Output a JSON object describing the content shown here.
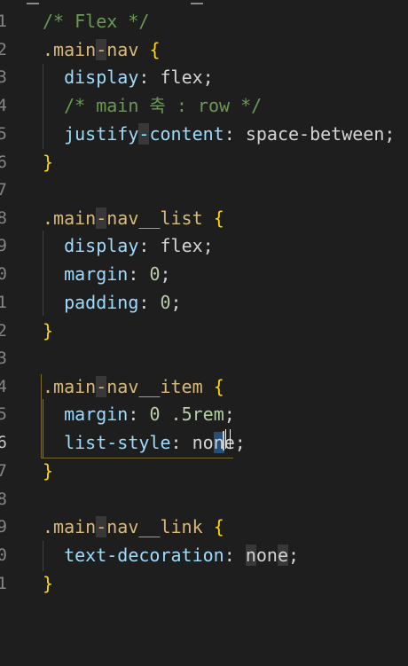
{
  "editor": {
    "language": "CSS",
    "active_line_number": "6",
    "lines": [
      {
        "number": "1",
        "text": "/* Flex */"
      },
      {
        "number": "2",
        "text": ".main-nav {"
      },
      {
        "number": "3",
        "text": "  display: flex;"
      },
      {
        "number": "4",
        "text": "  /* main 축 : row */"
      },
      {
        "number": "5",
        "text": "  justify-content: space-between;"
      },
      {
        "number": "6",
        "text": "}"
      },
      {
        "number": "7",
        "text": ""
      },
      {
        "number": "8",
        "text": ".main-nav__list {"
      },
      {
        "number": "9",
        "text": "  display: flex;"
      },
      {
        "number": "0",
        "text": "  margin: 0;"
      },
      {
        "number": "1",
        "text": "  padding: 0;"
      },
      {
        "number": "2",
        "text": "}"
      },
      {
        "number": "3",
        "text": ""
      },
      {
        "number": "4",
        "text": ".main-nav__item {"
      },
      {
        "number": "5",
        "text": "  margin: 0 .5rem;"
      },
      {
        "number": "6",
        "text": "  list-style: none;"
      },
      {
        "number": "7",
        "text": "}"
      },
      {
        "number": "8",
        "text": ""
      },
      {
        "number": "9",
        "text": ".main-nav__link {"
      },
      {
        "number": "0",
        "text": "  text-decoration: none;"
      },
      {
        "number": "1",
        "text": "}"
      }
    ]
  },
  "colors": {
    "background": "#1e1e1e",
    "comment": "#6a9955",
    "selector": "#d7ba7d",
    "brace": "#ffd700",
    "property": "#9cdcfe",
    "number": "#b5cea8",
    "line_number": "#858585"
  },
  "icons": {
    "text_cursor": "i-beam-cursor-icon"
  }
}
